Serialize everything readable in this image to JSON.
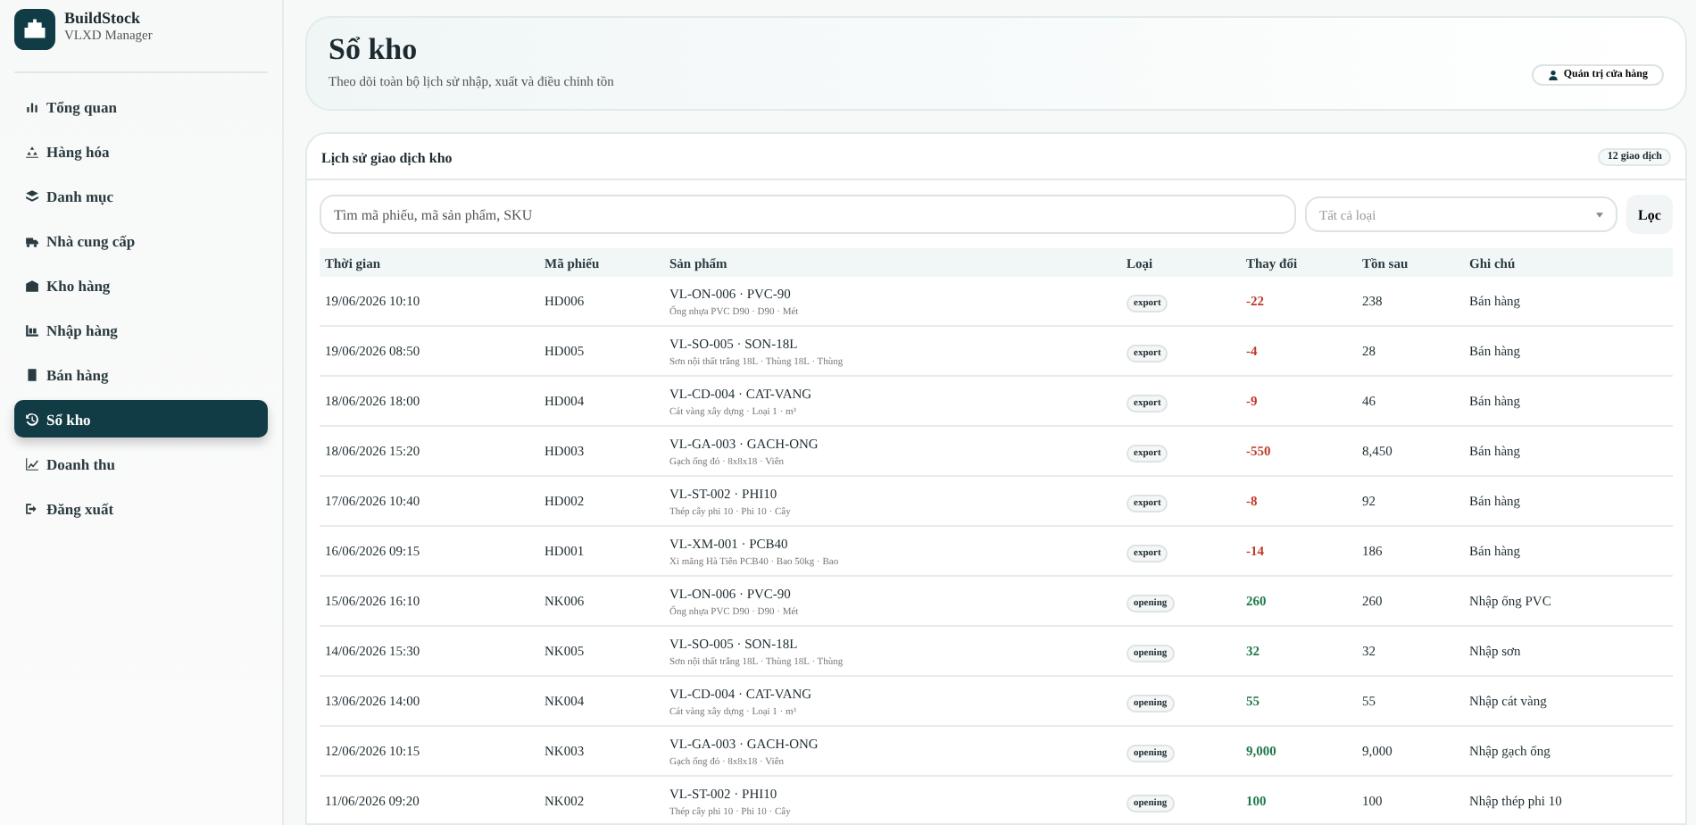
{
  "brand": {
    "name": "BuildStock",
    "subtitle": "VLXD Manager"
  },
  "sidebar": {
    "items": [
      {
        "label": "Tổng quan",
        "selected": false
      },
      {
        "label": "Hàng hóa",
        "selected": false
      },
      {
        "label": "Danh mục",
        "selected": false
      },
      {
        "label": "Nhà cung cấp",
        "selected": false
      },
      {
        "label": "Kho hàng",
        "selected": false
      },
      {
        "label": "Nhập hàng",
        "selected": false
      },
      {
        "label": "Bán hàng",
        "selected": false
      },
      {
        "label": "Sổ kho",
        "selected": true
      },
      {
        "label": "Doanh thu",
        "selected": false
      },
      {
        "label": "Đăng xuất",
        "selected": false
      }
    ]
  },
  "header": {
    "title": "Sổ kho",
    "subtitle": "Theo dõi toàn bộ lịch sử nhập, xuất và điều chỉnh tồn",
    "user_button": "Quản trị cửa hàng"
  },
  "panel": {
    "title": "Lịch sử giao dịch kho",
    "count_badge": "12 giao dịch",
    "search": {
      "placeholder": "Tìm mã phiếu, mã sản phẩm, SKU"
    },
    "type_filter": {
      "placeholder": "Tất cả loại"
    },
    "filter_button": "Lọc"
  },
  "table": {
    "columns": [
      "Thời gian",
      "Mã phiếu",
      "Sản phẩm",
      "Loại",
      "Thay đổi",
      "Tồn sau",
      "Ghi chú"
    ],
    "rows": [
      {
        "time": "19/06/2026 10:10",
        "code": "HD006",
        "product": "VL-ON-006 · PVC-90",
        "detail": "Ống nhựa PVC D90 · D90 · Mét",
        "type": "export",
        "kind": "out",
        "change": "-22",
        "after": "238",
        "note": "Bán hàng"
      },
      {
        "time": "19/06/2026 08:50",
        "code": "HD005",
        "product": "VL-SO-005 · SON-18L",
        "detail": "Sơn nội thất trắng 18L · Thùng 18L · Thùng",
        "type": "export",
        "kind": "out",
        "change": "-4",
        "after": "28",
        "note": "Bán hàng"
      },
      {
        "time": "18/06/2026 18:00",
        "code": "HD004",
        "product": "VL-CD-004 · CAT-VANG",
        "detail": "Cát vàng xây dựng · Loại 1 · m³",
        "type": "export",
        "kind": "out",
        "change": "-9",
        "after": "46",
        "note": "Bán hàng"
      },
      {
        "time": "18/06/2026 15:20",
        "code": "HD003",
        "product": "VL-GA-003 · GACH-ONG",
        "detail": "Gạch ống đỏ · 8x8x18 · Viên",
        "type": "export",
        "kind": "out",
        "change": "-550",
        "after": "8,450",
        "note": "Bán hàng"
      },
      {
        "time": "17/06/2026 10:40",
        "code": "HD002",
        "product": "VL-ST-002 · PHI10",
        "detail": "Thép cây phi 10 · Phi 10 · Cây",
        "type": "export",
        "kind": "out",
        "change": "-8",
        "after": "92",
        "note": "Bán hàng"
      },
      {
        "time": "16/06/2026 09:15",
        "code": "HD001",
        "product": "VL-XM-001 · PCB40",
        "detail": "Xi măng Hà Tiên PCB40 · Bao 50kg · Bao",
        "type": "export",
        "kind": "out",
        "change": "-14",
        "after": "186",
        "note": "Bán hàng"
      },
      {
        "time": "15/06/2026 16:10",
        "code": "NK006",
        "product": "VL-ON-006 · PVC-90",
        "detail": "Ống nhựa PVC D90 · D90 · Mét",
        "type": "opening",
        "kind": "in",
        "change": "260",
        "after": "260",
        "note": "Nhập ống PVC"
      },
      {
        "time": "14/06/2026 15:30",
        "code": "NK005",
        "product": "VL-SO-005 · SON-18L",
        "detail": "Sơn nội thất trắng 18L · Thùng 18L · Thùng",
        "type": "opening",
        "kind": "in",
        "change": "32",
        "after": "32",
        "note": "Nhập sơn"
      },
      {
        "time": "13/06/2026 14:00",
        "code": "NK004",
        "product": "VL-CD-004 · CAT-VANG",
        "detail": "Cát vàng xây dựng · Loại 1 · m³",
        "type": "opening",
        "kind": "in",
        "change": "55",
        "after": "55",
        "note": "Nhập cát vàng"
      },
      {
        "time": "12/06/2026 10:15",
        "code": "NK003",
        "product": "VL-GA-003 · GACH-ONG",
        "detail": "Gạch ống đỏ · 8x8x18 · Viên",
        "type": "opening",
        "kind": "in",
        "change": "9,000",
        "after": "9,000",
        "note": "Nhập gạch ống"
      },
      {
        "time": "11/06/2026 09:20",
        "code": "NK002",
        "product": "VL-ST-002 · PHI10",
        "detail": "Thép cây phi 10 · Phi 10 · Cây",
        "type": "opening",
        "kind": "in",
        "change": "100",
        "after": "100",
        "note": "Nhập thép phi 10"
      }
    ]
  }
}
